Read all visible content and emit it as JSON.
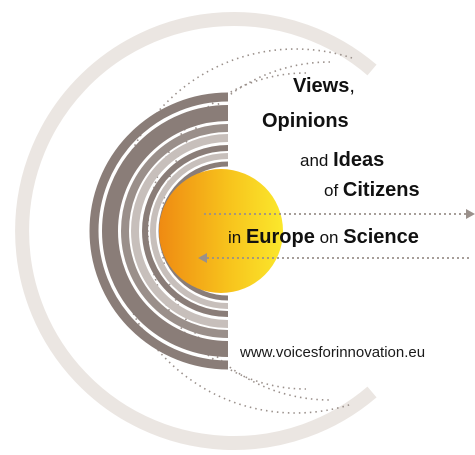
{
  "logo": {
    "line1_strong": "Views",
    "line1_comma": ",",
    "line2": "Opinions",
    "line3_small": "and ",
    "line3_strong": "Ideas",
    "line4_small": "of ",
    "line4_strong": "Citizens",
    "line5_small1": "in ",
    "line5_strong1": "Europe",
    "line5_small2": " on ",
    "line5_strong2": "Science",
    "website": "www.voicesforinnovation.eu"
  },
  "colors": {
    "ring_dark": "#8a7d78",
    "ring_light": "#c4bcb8",
    "sun_left": "#f08c14",
    "sun_right": "#fbe52a",
    "arc_light": "#e9e4e0",
    "dots": "#9a908b"
  },
  "icons": [
    "arrow-right-icon",
    "arrow-left-icon"
  ]
}
